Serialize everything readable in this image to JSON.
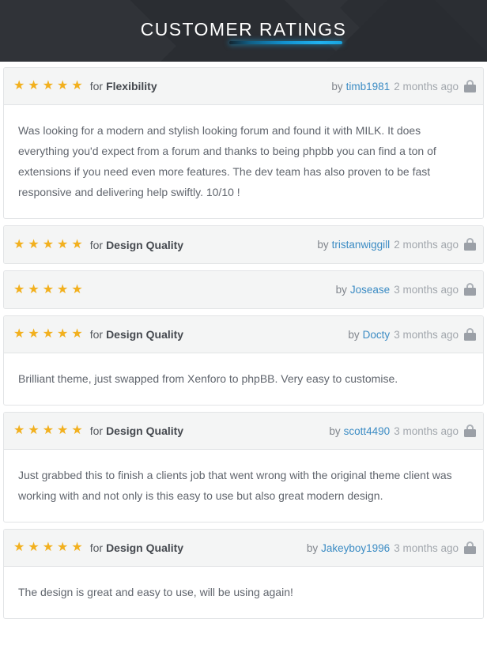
{
  "header": {
    "title": "CUSTOMER RATINGS",
    "accent_color": "#18a2dd",
    "background_color": "#2d3035"
  },
  "theme": {
    "star_color": "#f2b01e",
    "link_color": "#3c8cc4",
    "row_background": "#f4f5f5",
    "card_border": "#e2e4e6",
    "body_text_color": "#60656d"
  },
  "icons": {
    "star": "★",
    "lock": "lock-icon"
  },
  "labels": {
    "for": "for",
    "by": "by"
  },
  "reviews": [
    {
      "stars": 5,
      "category": "Flexibility",
      "has_category": true,
      "author": "timb1981",
      "when": "2 months ago",
      "locked": true,
      "body": "Was looking for a modern and stylish looking forum and found it with MILK. It does everything you'd expect from a forum and thanks to being phpbb you can find a ton of extensions if you need even more features. The dev team has also proven to be fast responsive and delivering help swiftly. 10/10 !"
    },
    {
      "stars": 5,
      "category": "Design Quality",
      "has_category": true,
      "author": "tristanwiggill",
      "when": "2 months ago",
      "locked": true,
      "body": ""
    },
    {
      "stars": 5,
      "category": "",
      "has_category": false,
      "author": "Josease",
      "when": "3 months ago",
      "locked": true,
      "body": ""
    },
    {
      "stars": 5,
      "category": "Design Quality",
      "has_category": true,
      "author": "Docty",
      "when": "3 months ago",
      "locked": true,
      "body": "Brilliant theme, just swapped from Xenforo to phpBB. Very easy to customise."
    },
    {
      "stars": 5,
      "category": "Design Quality",
      "has_category": true,
      "author": "scott4490",
      "when": "3 months ago",
      "locked": true,
      "body": "Just grabbed this to finish a clients job that went wrong with the original theme client was working with and not only is this easy to use but also great modern design."
    },
    {
      "stars": 5,
      "category": "Design Quality",
      "has_category": true,
      "author": "Jakeyboy1996",
      "when": "3 months ago",
      "locked": true,
      "body": "The design is great and easy to use, will be using again!"
    }
  ]
}
